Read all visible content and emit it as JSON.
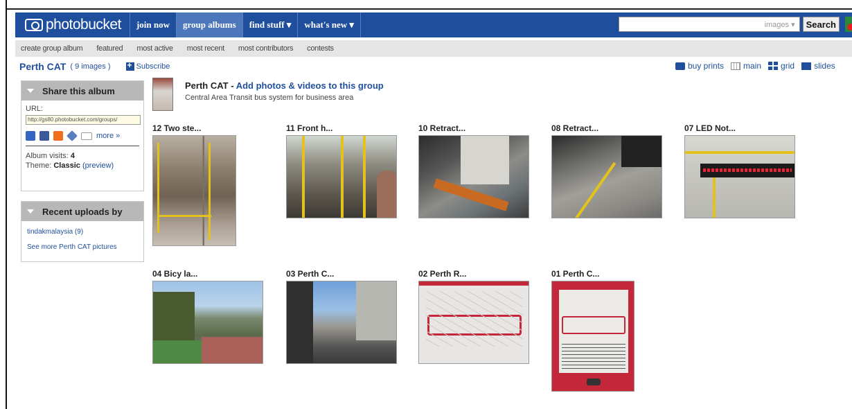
{
  "nav": {
    "brand": "photobucket",
    "items": [
      {
        "label": "join now"
      },
      {
        "label": "group albums"
      },
      {
        "label": "find stuff ▾"
      },
      {
        "label": "what's new ▾"
      }
    ]
  },
  "search": {
    "scope": "images ▾",
    "button": "Search"
  },
  "subnav": [
    "create group album",
    "featured",
    "most active",
    "most recent",
    "most contributors",
    "contests"
  ],
  "album": {
    "title": "Perth CAT",
    "count": "( 9 images )",
    "subscribe": "Subscribe"
  },
  "view_options": {
    "buy_prints": "buy prints",
    "main": "main",
    "grid": "grid",
    "slideshow": "slides"
  },
  "share_panel": {
    "title": "Share this album",
    "url_label": "URL:",
    "url_value": "http://gs80.photobucket.com/groups/",
    "more": "more »",
    "visits_label": "Album visits:",
    "visits_value": "4",
    "theme_label": "Theme:",
    "theme_value": "Classic",
    "preview": "(preview)"
  },
  "recent_panel": {
    "title": "Recent uploads by",
    "uploader": "tindakmalaysia (9)",
    "see_more": "See more Perth CAT pictures"
  },
  "group": {
    "title": "Perth CAT",
    "sep": " - ",
    "add_link": "Add photos & videos to this group",
    "description": "Central Area Transit bus system for business area"
  },
  "photos": [
    {
      "caption": "12 Two ste..."
    },
    {
      "caption": "11 Front h..."
    },
    {
      "caption": "10 Retract..."
    },
    {
      "caption": "08 Retract..."
    },
    {
      "caption": "07 LED Not..."
    },
    {
      "caption": "04 Bicy la..."
    },
    {
      "caption": "03 Perth C..."
    },
    {
      "caption": "02 Perth R..."
    },
    {
      "caption": "01 Perth C..."
    }
  ],
  "colors": {
    "nav_blue": "#1f4f9c",
    "active_tab": "#4d77bb",
    "panel_head": "#b8b8b8"
  }
}
